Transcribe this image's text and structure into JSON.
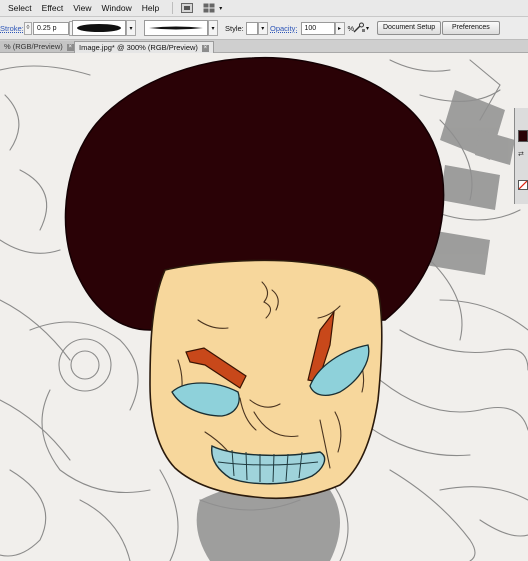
{
  "menu": [
    "Select",
    "Effect",
    "View",
    "Window",
    "Help"
  ],
  "control_bar": {
    "stroke_label": "Stroke:",
    "stroke_weight": "0.25 p",
    "style_label": "Style:",
    "opacity_label": "Opacity:",
    "opacity_value": "100",
    "opacity_unit": "%",
    "document_setup_label": "Document Setup",
    "preferences_label": "Preferences"
  },
  "tabs": [
    {
      "label": "% (RGB/Preview)",
      "active": false
    },
    {
      "label": "Image.jpg* @ 300% (RGB/Preview)",
      "active": true
    }
  ],
  "artwork": {
    "hair_color": "#2a0206",
    "skin_color": "#f7d79c",
    "brow_color": "#c8481a",
    "eye_color": "#8ed1da",
    "sketch_color": "#6b6b6b",
    "background_color": "#f1efec"
  },
  "icons": {
    "bridge": "bridge-icon",
    "arrange": "arrange-documents-icon",
    "swatch": "fill-swatch-icon",
    "swap": "swap-arrow-icon",
    "none": "none-swatch-icon"
  }
}
